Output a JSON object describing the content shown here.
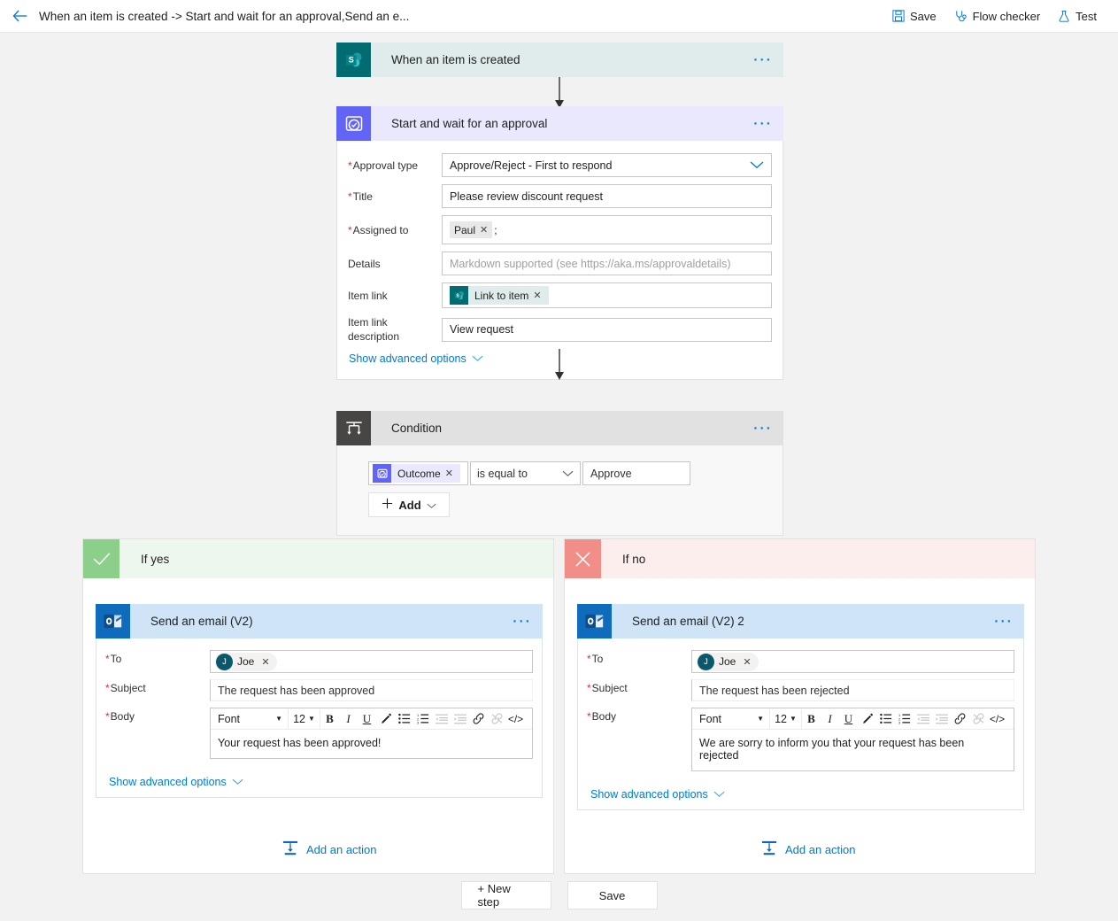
{
  "commandbar": {
    "back_icon": "back-arrow-icon",
    "title": "When an item is created -> Start and wait for an approval,Send an e...",
    "actions": [
      {
        "label": "Save",
        "icon": "save-disk-icon"
      },
      {
        "label": "Flow checker",
        "icon": "stethoscope-icon"
      },
      {
        "label": "Test",
        "icon": "flask-icon"
      }
    ]
  },
  "trigger": {
    "title": "When an item is created",
    "icon": "sharepoint-icon",
    "menu_icon": "ellipsis-icon"
  },
  "approval": {
    "title": "Start and wait for an approval",
    "icon": "approvals-icon",
    "menu_icon": "ellipsis-icon",
    "fields": {
      "approval_type": {
        "label": "Approval type",
        "required": true,
        "value": "Approve/Reject - First to respond"
      },
      "title": {
        "label": "Title",
        "required": true,
        "value": "Please review discount request"
      },
      "assigned_to": {
        "label": "Assigned to",
        "required": true,
        "token": "Paul",
        "trailing": ";"
      },
      "details": {
        "label": "Details",
        "required": false,
        "placeholder": "Markdown supported (see https://aka.ms/approvaldetails)"
      },
      "item_link": {
        "label": "Item link",
        "required": false,
        "token": "Link to item"
      },
      "item_link_description": {
        "label": "Item link description",
        "required": false,
        "value": "View request"
      }
    },
    "advanced_label": "Show advanced options"
  },
  "condition": {
    "title": "Condition",
    "icon": "condition-icon",
    "menu_icon": "ellipsis-icon",
    "left_token": "Outcome",
    "operator": "is equal to",
    "right_value": "Approve",
    "add_label": "Add"
  },
  "branch_yes": {
    "label": "If yes",
    "badge_icon": "checkmark-icon",
    "email": {
      "title": "Send an email (V2)",
      "icon": "outlook-icon",
      "menu_icon": "ellipsis-icon",
      "to_label": "To",
      "to_token": "Joe",
      "to_avatar": "J",
      "subject_label": "Subject",
      "subject_value": "The request has been approved",
      "body_label": "Body",
      "body_value": "Your request has been approved!",
      "advanced_label": "Show advanced options"
    },
    "add_action_label": "Add an action"
  },
  "branch_no": {
    "label": "If no",
    "badge_icon": "close-x-icon",
    "email": {
      "title": "Send an email (V2) 2",
      "icon": "outlook-icon",
      "menu_icon": "ellipsis-icon",
      "to_label": "To",
      "to_token": "Joe",
      "to_avatar": "J",
      "subject_label": "Subject",
      "subject_value": "The request has been rejected",
      "body_label": "Body",
      "body_value": "We are sorry to inform you that your request has been rejected",
      "advanced_label": "Show advanced options"
    },
    "add_action_label": "Add an action"
  },
  "rte_toolbar": {
    "font_label": "Font",
    "size_label": "12",
    "buttons": [
      {
        "name": "bold",
        "glyph": "B"
      },
      {
        "name": "italic",
        "glyph": "I"
      },
      {
        "name": "underline",
        "glyph": "U"
      },
      {
        "name": "font-color",
        "glyph": "pen"
      },
      {
        "name": "bulleted-list",
        "glyph": "bullets"
      },
      {
        "name": "numbered-list",
        "glyph": "numbers"
      },
      {
        "name": "decrease-indent",
        "glyph": "outdent"
      },
      {
        "name": "increase-indent",
        "glyph": "indent"
      },
      {
        "name": "insert-link",
        "glyph": "link"
      },
      {
        "name": "remove-link",
        "glyph": "unlink"
      },
      {
        "name": "code-view",
        "glyph": "</>"
      }
    ]
  },
  "footer": {
    "new_step_label": "+ New step",
    "save_label": "Save"
  },
  "colors": {
    "accent": "#0078d4",
    "sharepoint": "#036c70",
    "approvals": "#6264f5",
    "outlook": "#0f6cbd",
    "condition": "#484644",
    "yes_badge": "#8bcf8b",
    "no_badge": "#f08e87",
    "required": "#d13438"
  }
}
